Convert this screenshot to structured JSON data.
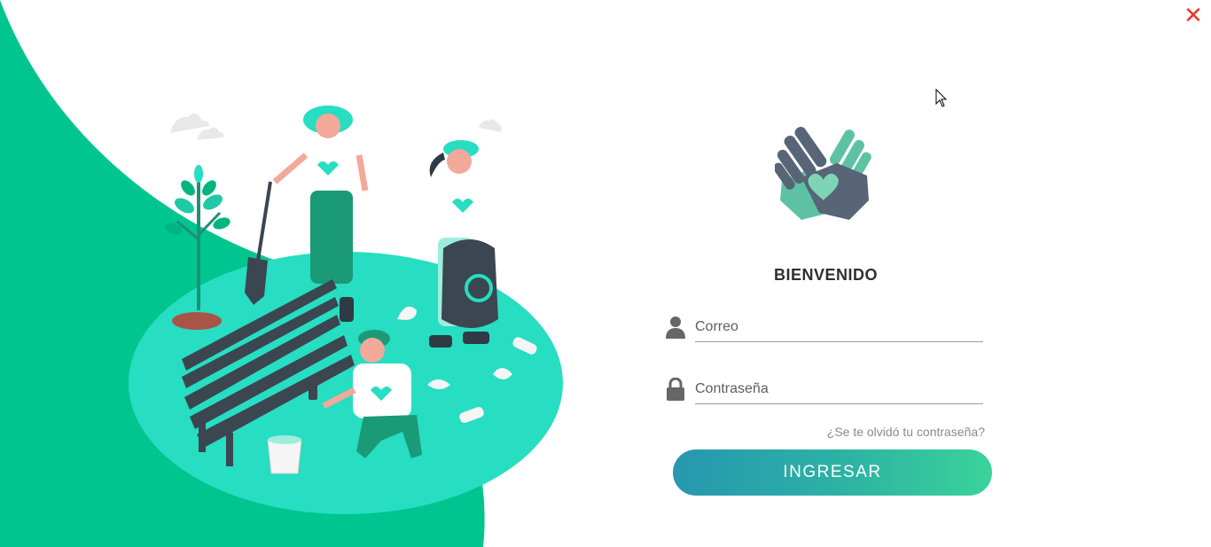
{
  "window": {
    "close_icon": "close-icon",
    "close_glyph": "✕",
    "accent": "#e8392b"
  },
  "illustration": {
    "description_icon": "volunteers-illustration",
    "colors": {
      "dark_green": "#00c58e",
      "light_green": "#27ddc2",
      "shirt": "#ffffff"
    }
  },
  "login": {
    "logo_icon": "helping-hands-heart-icon",
    "title": "BIENVENIDO",
    "email": {
      "icon": "user-icon",
      "placeholder": "Correo",
      "value": ""
    },
    "password": {
      "icon": "lock-icon",
      "placeholder": "Contraseña",
      "value": ""
    },
    "forgot_link": "¿Se te olvidó tu contraseña?",
    "submit_label": "INGRESAR",
    "button_gradient": [
      "#2697b0",
      "#3ad39a"
    ]
  }
}
